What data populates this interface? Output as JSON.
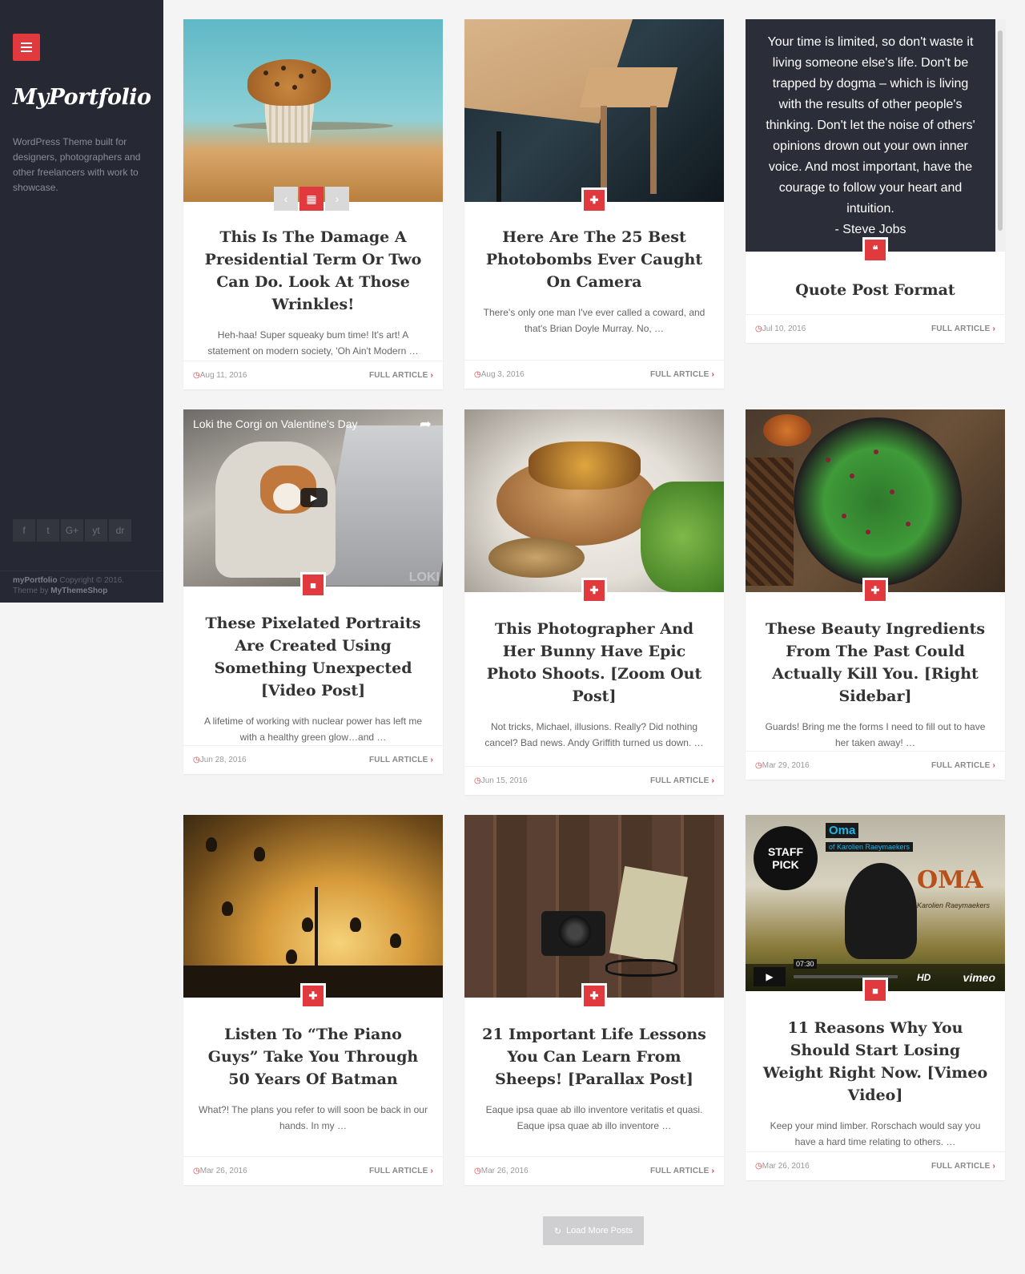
{
  "sidebar": {
    "logo": "MyPortfolio",
    "tagline": "WordPress Theme built for designers, photographers and other freelancers with work to showcase.",
    "social": [
      "f",
      "t",
      "G+",
      "yt",
      "dr"
    ],
    "copyright_brand": "myPortfolio",
    "copyright_text": " Copyright © 2016.",
    "theme_by_text": "Theme by ",
    "theme_by_brand": "MyThemeShop"
  },
  "gallery_nav": {
    "prev": "‹",
    "grid": "▦",
    "next": "›"
  },
  "video": {
    "title": "Loki the Corgi on Valentine's Day",
    "share": "➦",
    "play": "▶",
    "watermark": "LOKI"
  },
  "vimeo": {
    "staff": "STAFF PICK",
    "name": "Oma",
    "by": "of Karolien Raeymaekers",
    "big": "OMA",
    "sub": "Karolien Raeymaekers",
    "time": "07:30",
    "logo": "vimeo",
    "hd": "HD"
  },
  "quote": {
    "text": "Your time is limited, so don't waste it living someone else's life. Don't be trapped by dogma – which is living with the results of other people's thinking. Don't let the noise of others' opinions drown out your own inner voice. And most important, have the courage to follow your heart and intuition.",
    "author": "- Steve Jobs"
  },
  "full_article": "FULL ARTICLE",
  "posts": [
    {
      "title": "This Is The Damage A Presidential Term Or Two Can Do. Look At Those Wrinkles!",
      "excerpt": "Heh-haa! Super squeaky bum time! It's art! A statement on modern society, 'Oh Ain't Modern …",
      "date": "Aug 11, 2016",
      "badge": "▦"
    },
    {
      "title": "Here Are The 25 Best Photobombs Ever Caught On Camera",
      "excerpt": "There's only one man I've ever called a coward, and that's Brian Doyle Murray. No, …",
      "date": "Aug 3, 2016",
      "badge": "✚"
    },
    {
      "title": "Quote Post Format",
      "excerpt": "",
      "date": "Jul 10, 2016",
      "badge": "❝"
    },
    {
      "title": "These Pixelated Portraits Are Created Using Something Unexpected [Video Post]",
      "excerpt": "A lifetime of working with nuclear power has left me with a healthy green glow…and …",
      "date": "Jun 28, 2016",
      "badge": "■"
    },
    {
      "title": "This Photographer And Her Bunny Have Epic Photo Shoots. [Zoom Out Post]",
      "excerpt": "Not tricks, Michael, illusions. Really? Did nothing cancel? Bad news. Andy Griffith turned us down. …",
      "date": "Jun 15, 2016",
      "badge": "✚"
    },
    {
      "title": "These Beauty Ingredients From The Past Could Actually Kill You. [Right Sidebar]",
      "excerpt": "Guards! Bring me the forms I need to fill out to have her taken away! …",
      "date": "Mar 29, 2016",
      "badge": "✚"
    },
    {
      "title": "Listen To “The Piano Guys” Take You Through 50 Years Of Batman",
      "excerpt": "What?! The plans you refer to will soon be back in our hands. In my …",
      "date": "Mar 26, 2016",
      "badge": "✚"
    },
    {
      "title": "21 Important Life Lessons You Can Learn From Sheeps! [Parallax Post]",
      "excerpt": "Eaque ipsa quae ab illo inventore veritatis et quasi. Eaque ipsa quae ab illo inventore …",
      "date": "Mar 26, 2016",
      "badge": "✚"
    },
    {
      "title": "11 Reasons Why You Should Start Losing Weight Right Now. [Vimeo Video]",
      "excerpt": "Keep your mind limber. Rorschach would say you have a hard time relating to others. …",
      "date": "Mar 26, 2016",
      "badge": "■"
    }
  ],
  "load_more": {
    "icon": "↻",
    "label": "Load More Posts"
  },
  "colors": {
    "accent": "#e0393e",
    "sidebar": "#262833"
  }
}
